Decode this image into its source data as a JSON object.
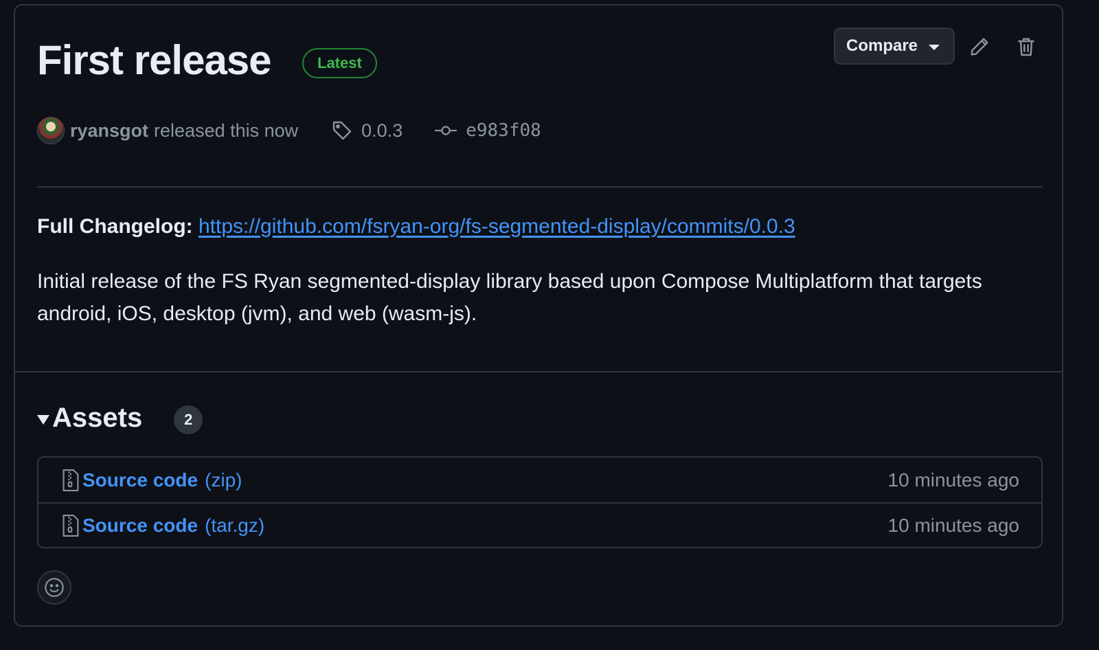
{
  "release": {
    "title": "First release",
    "badge": "Latest",
    "compare_label": "Compare",
    "author": "ryansgot",
    "released_text": "released this now",
    "tag": "0.0.3",
    "commit": "e983f08",
    "changelog_label": "Full Changelog:",
    "changelog_url": "https://github.com/fsryan-org/fs-segmented-display/commits/0.0.3",
    "description": "Initial release of the FS Ryan segmented-display library based upon Compose Multiplatform that targets android, iOS, desktop (jvm), and web (wasm-js)."
  },
  "assets": {
    "title": "Assets",
    "count": "2",
    "items": [
      {
        "name": "Source code",
        "ext": "(zip)",
        "time": "10 minutes ago",
        "icon": "file-zip-icon"
      },
      {
        "name": "Source code",
        "ext": "(tar.gz)",
        "time": "10 minutes ago",
        "icon": "file-zip-icon"
      }
    ]
  },
  "icons": {
    "edit": "pencil-icon",
    "delete": "trash-icon",
    "tag": "tag-icon",
    "commit": "git-commit-icon",
    "reaction": "smiley-icon"
  },
  "colors": {
    "background": "#0d1117",
    "border": "#30363d",
    "link": "#4493f8",
    "badge_green": "#3fb950",
    "muted": "#8b949e",
    "text": "#e6edf3"
  }
}
